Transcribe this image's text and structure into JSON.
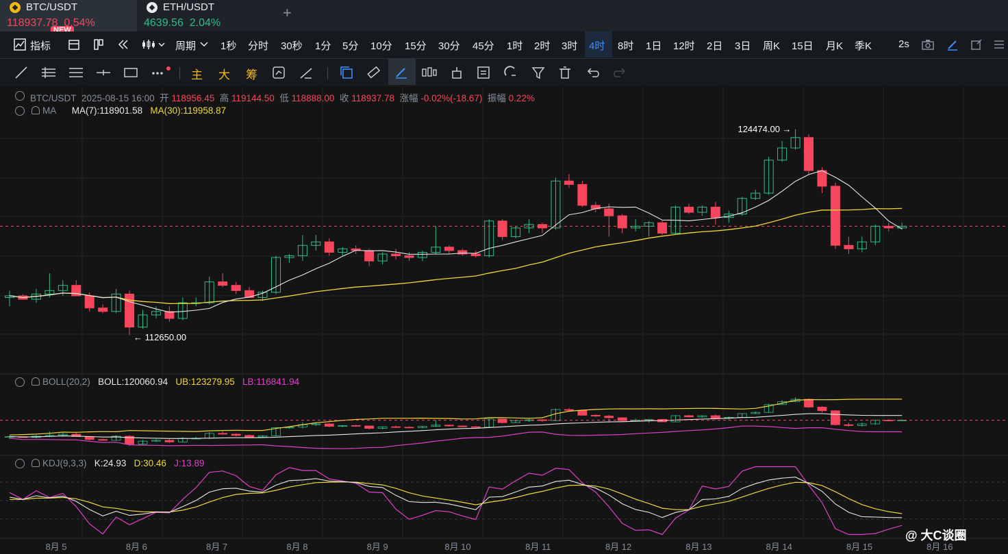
{
  "tabs": [
    {
      "symbol": "BTC/USDT",
      "price": "118937.78",
      "change": "0.54%",
      "badge": "NEW"
    },
    {
      "symbol": "ETH/USDT",
      "price": "4639.56",
      "change": "2.04%"
    }
  ],
  "toolbar1": {
    "indicator_label": "指标",
    "period_label": "周期",
    "intervals": [
      "1秒",
      "分时",
      "30秒",
      "1分",
      "5分",
      "10分",
      "15分",
      "30分",
      "45分",
      "1时",
      "2时",
      "3时",
      "4时",
      "8时",
      "1日",
      "12时",
      "2日",
      "3日",
      "周K",
      "15日",
      "月K",
      "季K"
    ],
    "selected_interval": "4时",
    "refresh": "2s"
  },
  "toolbar2": {
    "main_label": "主",
    "big_label": "大",
    "chip_label": "筹"
  },
  "ohlc_legend": {
    "symbol": "BTC/USDT",
    "datetime": "2025-08-15 16:00",
    "open_label": "开",
    "open": "118956.45",
    "high_label": "高",
    "high": "119144.50",
    "low_label": "低",
    "low": "118888.00",
    "close_label": "收",
    "close": "118937.78",
    "change_label": "涨幅",
    "change": "-0.02%(-18.67)",
    "amp_label": "振幅",
    "amp": "0.22%"
  },
  "ma_legend": {
    "name": "MA",
    "ma7": "MA(7):118901.58",
    "ma30": "MA(30):119958.87"
  },
  "boll_legend": {
    "name": "BOLL(20,2)",
    "boll": "BOLL:120060.94",
    "ub": "UB:123279.95",
    "lb": "LB:116841.94"
  },
  "kdj_legend": {
    "name": "KDJ(9,3,3)",
    "k": "K:24.93",
    "d": "D:30.46",
    "j": "J:13.89"
  },
  "watermark": "@ 大C谈圈",
  "colors": {
    "up": "#2ebd85",
    "down": "#f6465d",
    "ma7": "#e8e8e8",
    "ma30": "#f0d83a",
    "boll_lb": "#e040c8",
    "active": "#3d8ef8"
  },
  "chart_data": {
    "type": "candlestick",
    "x_ticks": [
      "8月 5",
      "8月 6",
      "8月 7",
      "8月 8",
      "8月 9",
      "8月 10",
      "8月 11",
      "8月 12",
      "8月 13",
      "8月 14",
      "8月 15",
      "8月 16"
    ],
    "max_marker": "124474.00",
    "min_marker": "112650.00",
    "candles": [
      [
        114800,
        115200,
        114300,
        114900
      ],
      [
        114900,
        115000,
        114700,
        114700
      ],
      [
        114700,
        115300,
        114500,
        115000
      ],
      [
        115000,
        116200,
        114800,
        115200
      ],
      [
        115200,
        115800,
        114900,
        115500
      ],
      [
        115500,
        115800,
        114900,
        114900
      ],
      [
        114900,
        115100,
        114000,
        114200
      ],
      [
        114200,
        114400,
        113900,
        114000
      ],
      [
        114000,
        115300,
        113900,
        115000
      ],
      [
        115000,
        115200,
        112650,
        113100
      ],
      [
        113100,
        114100,
        113000,
        113800
      ],
      [
        113800,
        114300,
        113600,
        114000
      ],
      [
        114000,
        114300,
        113400,
        113600
      ],
      [
        113600,
        114800,
        113500,
        114500
      ],
      [
        114500,
        114800,
        114300,
        114500
      ],
      [
        114500,
        116000,
        114400,
        115700
      ],
      [
        115700,
        116200,
        115400,
        115500
      ],
      [
        115500,
        115700,
        115000,
        115200
      ],
      [
        115200,
        115400,
        114800,
        114800
      ],
      [
        114800,
        115200,
        114600,
        115100
      ],
      [
        115100,
        117200,
        115000,
        117100
      ],
      [
        117100,
        117300,
        116800,
        117200
      ],
      [
        117200,
        118400,
        116900,
        117800
      ],
      [
        117800,
        118400,
        117500,
        118000
      ],
      [
        118000,
        118200,
        117200,
        117400
      ],
      [
        117400,
        117700,
        117200,
        117600
      ],
      [
        117600,
        117800,
        117300,
        117500
      ],
      [
        117500,
        117600,
        116600,
        116900
      ],
      [
        116900,
        117400,
        116700,
        117300
      ],
      [
        117300,
        117600,
        117000,
        117200
      ],
      [
        117200,
        117400,
        116900,
        117100
      ],
      [
        117100,
        117500,
        116900,
        117400
      ],
      [
        117400,
        118900,
        117300,
        117700
      ],
      [
        117700,
        117800,
        117300,
        117500
      ],
      [
        117500,
        117600,
        117200,
        117300
      ],
      [
        117300,
        117500,
        117100,
        117200
      ],
      [
        117200,
        119300,
        117100,
        119200
      ],
      [
        119200,
        119300,
        118100,
        118300
      ],
      [
        118300,
        118900,
        118200,
        118800
      ],
      [
        118800,
        119300,
        118500,
        119000
      ],
      [
        119000,
        119100,
        118500,
        118800
      ],
      [
        118800,
        121700,
        118700,
        121500
      ],
      [
        121500,
        121900,
        121100,
        121300
      ],
      [
        121300,
        121500,
        120000,
        120100
      ],
      [
        120100,
        120300,
        119700,
        119900
      ],
      [
        119900,
        120200,
        118300,
        119500
      ],
      [
        119500,
        119600,
        118500,
        118800
      ],
      [
        118800,
        119300,
        118600,
        118900
      ],
      [
        118900,
        119200,
        118300,
        119100
      ],
      [
        119100,
        119200,
        118400,
        118500
      ],
      [
        118500,
        120100,
        118400,
        120000
      ],
      [
        120000,
        120200,
        119600,
        119700
      ],
      [
        119700,
        120100,
        119500,
        120000
      ],
      [
        120000,
        120300,
        119000,
        119400
      ],
      [
        119400,
        119800,
        119100,
        119600
      ],
      [
        119600,
        120600,
        119500,
        120500
      ],
      [
        120500,
        121000,
        120400,
        120800
      ],
      [
        120800,
        122900,
        120700,
        122700
      ],
      [
        122700,
        123800,
        122600,
        123400
      ],
      [
        123400,
        124474,
        123300,
        124000
      ],
      [
        124000,
        124200,
        121900,
        122100
      ],
      [
        122100,
        122300,
        120800,
        121200
      ],
      [
        121200,
        121400,
        117600,
        117800
      ],
      [
        117800,
        118300,
        117300,
        117600
      ],
      [
        117600,
        118300,
        117400,
        118000
      ],
      [
        118000,
        119000,
        117800,
        118900
      ],
      [
        118900,
        119100,
        118600,
        118800
      ],
      [
        118800,
        119100,
        118700,
        118900
      ]
    ]
  }
}
